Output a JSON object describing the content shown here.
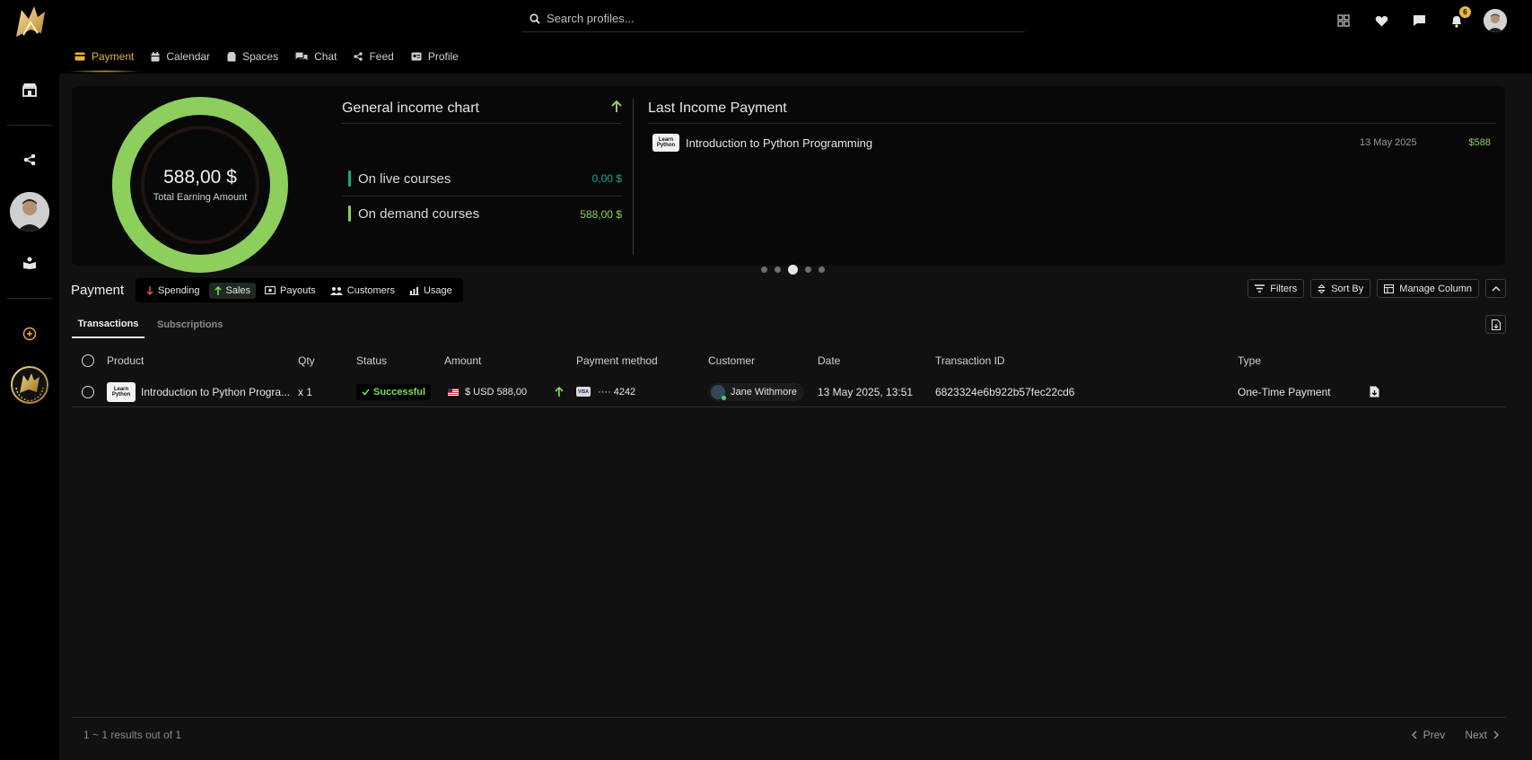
{
  "search": {
    "placeholder": "Search profiles..."
  },
  "top": {
    "notification_count": "6"
  },
  "nav_tabs": [
    {
      "label": "Payment",
      "icon": "credit-card-icon",
      "active": true
    },
    {
      "label": "Calendar",
      "icon": "calendar-icon",
      "active": false
    },
    {
      "label": "Spaces",
      "icon": "spaces-icon",
      "active": false
    },
    {
      "label": "Chat",
      "icon": "chat-icon",
      "active": false
    },
    {
      "label": "Feed",
      "icon": "share-icon",
      "active": false
    },
    {
      "label": "Profile",
      "icon": "id-card-icon",
      "active": false
    }
  ],
  "summary": {
    "total_value": "588,00 $",
    "total_label": "Total Earning Amount",
    "donut_fill_fraction": 1.0,
    "chart_title": "General income chart",
    "rows": [
      {
        "label": "On live courses",
        "value": "0,00 $",
        "color": "#1aa88a"
      },
      {
        "label": "On demand courses",
        "value": "588,00 $",
        "color": "#8dcf5c"
      }
    ]
  },
  "last_income": {
    "title": "Last Income Payment",
    "thumb_text": "Learn Python",
    "name": "Introduction to Python Programming",
    "date": "13 May 2025",
    "amount": "$588"
  },
  "carousel": {
    "count": 5,
    "active_index": 2
  },
  "payment": {
    "title": "Payment",
    "segments": [
      {
        "label": "Spending",
        "icon": "arrow-down-icon",
        "active": false
      },
      {
        "label": "Sales",
        "icon": "arrow-up-icon",
        "active": true
      },
      {
        "label": "Payouts",
        "icon": "money-icon",
        "active": false
      },
      {
        "label": "Customers",
        "icon": "users-icon",
        "active": false
      },
      {
        "label": "Usage",
        "icon": "usage-chart-icon",
        "active": false
      }
    ],
    "tools": {
      "filters": "Filters",
      "sort_by": "Sort By",
      "manage_column": "Manage Column"
    }
  },
  "subtabs": {
    "transactions": "Transactions",
    "subscriptions": "Subscriptions"
  },
  "table": {
    "headers": {
      "product": "Product",
      "qty": "Qty",
      "status": "Status",
      "amount": "Amount",
      "payment_method": "Payment method",
      "customer": "Customer",
      "date": "Date",
      "transaction_id": "Transaction ID",
      "type": "Type"
    },
    "rows": [
      {
        "thumb": "Learn Python",
        "product": "Introduction to Python Progra...",
        "qty": "x 1",
        "status": "Successful",
        "amount": "$ USD 588,00",
        "card_brand": "VISA",
        "card": "···· 4242",
        "customer": "Jane Withmore",
        "date": "13 May 2025, 13:51",
        "transaction_id": "6823324e6b922b57fec22cd6",
        "type": "One-Time Payment"
      }
    ]
  },
  "footer": {
    "results": "1 ~ 1 results out of 1",
    "prev": "Prev",
    "next": "Next"
  },
  "colors": {
    "accent": "#e7b33c",
    "success": "#7edc59",
    "donut": "#8dcf5c"
  }
}
